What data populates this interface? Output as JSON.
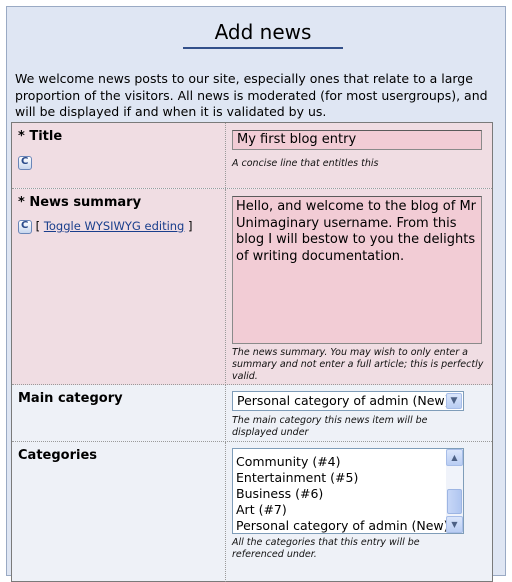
{
  "page": {
    "heading": "Add news",
    "intro": "We welcome news posts to our site, especially ones that relate to a large proportion of the visitors. All news is moderated (for most usergroups), and will be displayed if and when it is validated by us."
  },
  "form": {
    "title": {
      "required_mark": "*",
      "label": "Title",
      "value": "My first blog entry",
      "description": "A concise line that entitles this"
    },
    "news_summary": {
      "required_mark": "*",
      "label": "News summary",
      "toggle_open": "[",
      "toggle_label": "Toggle WYSIWYG editing",
      "toggle_close": "]",
      "value": "Hello, and welcome to the blog of Mr Unimaginary username. From this blog I will bestow to you the delights of writing documentation.",
      "description": "The news summary. You may wish to only enter a summary and not enter a full article; this is perfectly valid."
    },
    "main_category": {
      "label": "Main category",
      "selected": "Personal category of admin (New)",
      "description": "The main category this news item will be displayed under"
    },
    "categories": {
      "label": "Categories",
      "items": [
        "Community (#4)",
        "Entertainment (#5)",
        "Business (#6)",
        "Art (#7)",
        "Personal category of admin (New)"
      ],
      "description": "All the categories that this entry will be referenced under."
    }
  },
  "colors": {
    "panel_bg": "#dfe6f3",
    "required_row_bg": "#f0dde3",
    "required_field_bg": "#f2ccd5",
    "link": "#1a3e8c"
  },
  "icons": {
    "comcode": "comcode-icon",
    "dropdown": "chevron-down-icon",
    "scroll_up": "arrow-up-icon",
    "scroll_down": "arrow-down-icon"
  }
}
